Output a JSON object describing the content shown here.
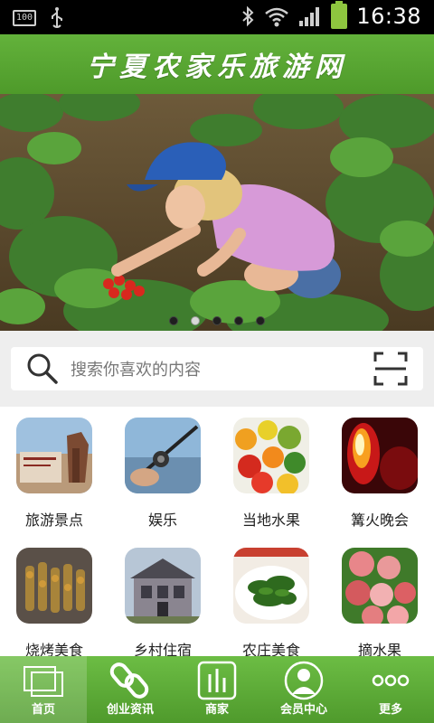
{
  "status_bar": {
    "time": "16:38",
    "battery_level": "100"
  },
  "header": {
    "title": "宁夏农家乐旅游网"
  },
  "banner": {
    "slide_count": 5,
    "active_slide": 2
  },
  "search": {
    "placeholder": "搜索你喜欢的内容"
  },
  "categories": [
    {
      "label": "旅游景点",
      "icon": "tourist-attraction-photo"
    },
    {
      "label": "娱乐",
      "icon": "fishing-photo"
    },
    {
      "label": "当地水果",
      "icon": "fruit-vegetables-photo"
    },
    {
      "label": "篝火晚会",
      "icon": "bonfire-photo"
    },
    {
      "label": "烧烤美食",
      "icon": "barbecue-photo"
    },
    {
      "label": "乡村住宿",
      "icon": "village-lodging-photo"
    },
    {
      "label": "农庄美食",
      "icon": "farm-dish-photo"
    },
    {
      "label": "摘水果",
      "icon": "peaches-photo"
    }
  ],
  "bottom_nav": [
    {
      "label": "首页",
      "icon": "home-icon",
      "active": true
    },
    {
      "label": "创业资讯",
      "icon": "link-icon",
      "active": false
    },
    {
      "label": "商家",
      "icon": "bar-chart-icon",
      "active": false
    },
    {
      "label": "会员中心",
      "icon": "user-icon",
      "active": false
    },
    {
      "label": "更多",
      "icon": "more-icon",
      "active": false
    }
  ],
  "colors": {
    "brand_green": "#5aa833",
    "status_bar": "#000000"
  }
}
